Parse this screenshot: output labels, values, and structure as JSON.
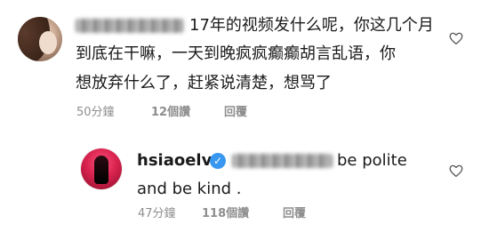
{
  "comments": [
    {
      "text_lines": [
        "17年的视频发什么呢，你这几个月",
        "到底在干嘛，一天到晚疯疯癫癫胡言乱语，你",
        "想放弃什么了，赶紧说清楚，想骂了"
      ],
      "time": "50分鐘",
      "likes": "12個讚",
      "reply": "回覆"
    },
    {
      "username": "hsiaoelva",
      "text_lines": [
        "be polite",
        "and be kind ."
      ],
      "time": "47分鐘",
      "likes": "118個讚",
      "reply": "回覆"
    }
  ],
  "icons": {
    "like": "heart-outline-icon",
    "verified": "verified-badge-icon"
  },
  "colors": {
    "verified": "#3897f0",
    "meta_text": "#8e8e8e"
  }
}
